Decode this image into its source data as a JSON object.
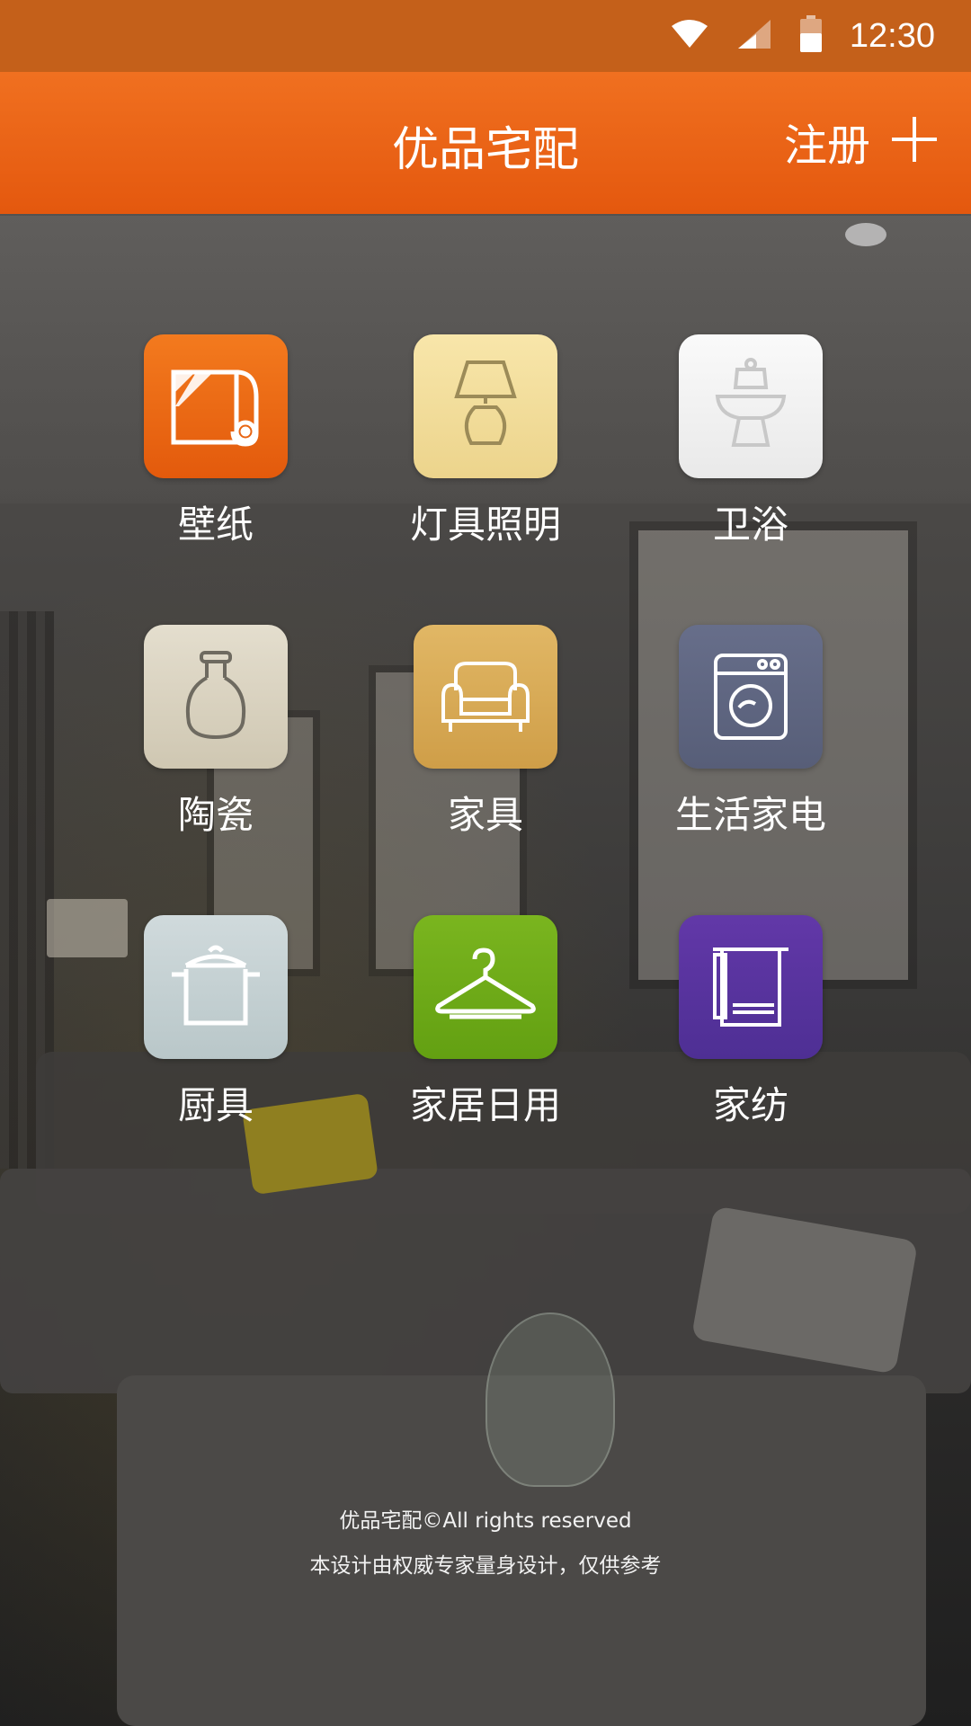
{
  "status_bar": {
    "time": "12:30",
    "icons": [
      "wifi-icon",
      "signal-icon",
      "battery-icon"
    ]
  },
  "app_bar": {
    "title": "优品宅配",
    "register_label": "注册",
    "register_icon": "plus-icon"
  },
  "categories": [
    {
      "label": "壁纸",
      "icon": "wallpaper-roll-icon",
      "color": "#ee6a14"
    },
    {
      "label": "灯具照明",
      "icon": "table-lamp-icon",
      "color": "#f2dc9a"
    },
    {
      "label": "卫浴",
      "icon": "toilet-icon",
      "color": "#f1f1f1"
    },
    {
      "label": "陶瓷",
      "icon": "ceramic-vase-icon",
      "color": "#d8d1bf"
    },
    {
      "label": "家具",
      "icon": "sofa-icon",
      "color": "#d7ab58"
    },
    {
      "label": "生活家电",
      "icon": "washing-machine-icon",
      "color": "#5e6580"
    },
    {
      "label": "厨具",
      "icon": "cooking-pot-icon",
      "color": "#c3d0d2"
    },
    {
      "label": "家居日用",
      "icon": "clothes-hanger-icon",
      "color": "#6aa81a"
    },
    {
      "label": "家纺",
      "icon": "towel-icon",
      "color": "#5a36a0"
    }
  ],
  "footer": {
    "copyright": "优品宅配©All rights reserved",
    "disclaimer": "本设计由权威专家量身设计，仅供参考"
  }
}
